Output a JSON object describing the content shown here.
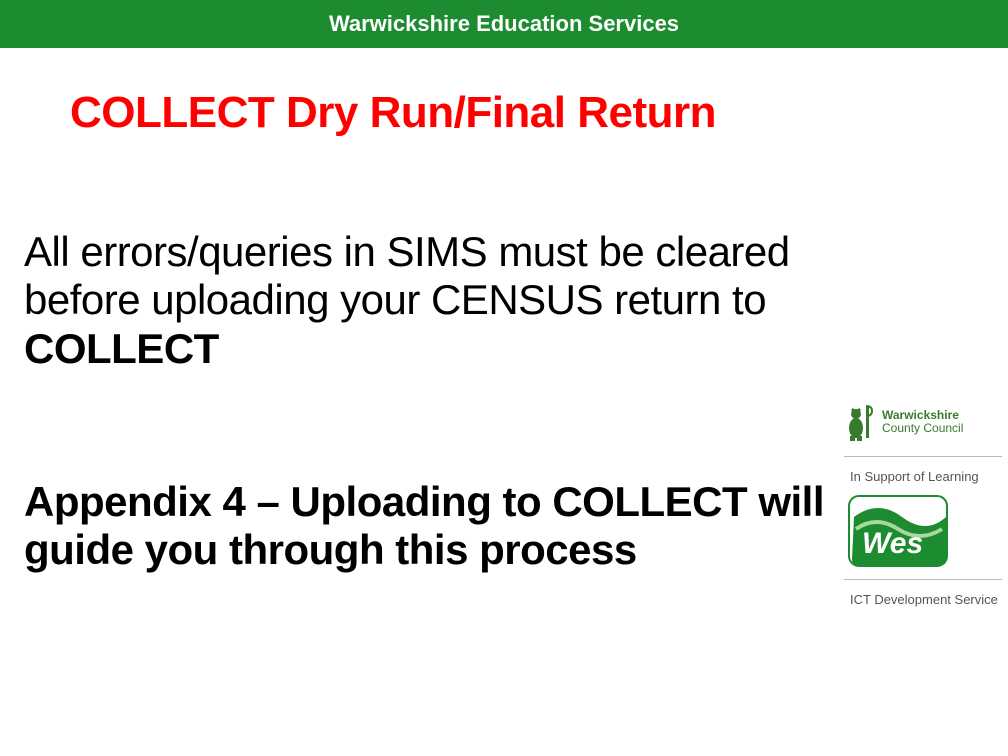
{
  "header": {
    "brand": "Warwickshire Education Services"
  },
  "title": "COLLECT Dry Run/Final Return",
  "body": {
    "p1_prefix": "All errors/queries in SIMS must be cleared before uploading your CENSUS return to ",
    "p1_bold": "COLLECT",
    "p2": "Appendix 4 – Uploading to COLLECT will guide you through this process"
  },
  "sidebar": {
    "county_line1": "Warwickshire",
    "county_line2": "County Council",
    "support": "In Support of Learning",
    "wes_label": "Wes",
    "ict": "ICT Development Service"
  },
  "colors": {
    "green": "#1d8b2f",
    "red": "#ff0000"
  }
}
